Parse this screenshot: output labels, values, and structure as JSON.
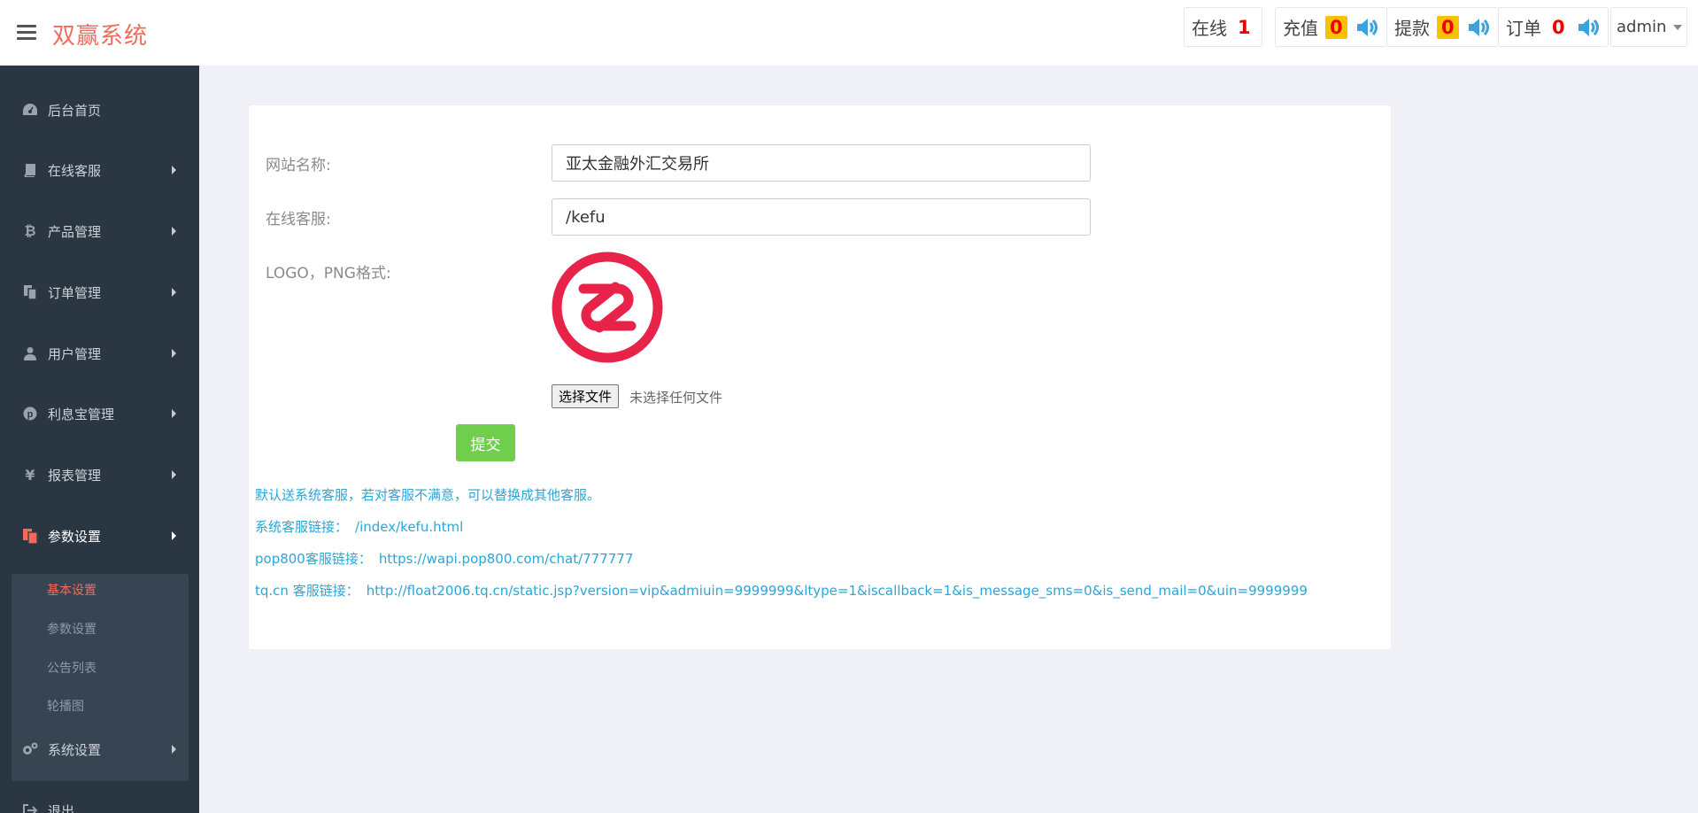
{
  "header": {
    "brand": "双赢系统",
    "stats": [
      {
        "label": "在线",
        "value": "1"
      },
      {
        "label": "充值",
        "value": "0"
      },
      {
        "label": "提款",
        "value": "0"
      },
      {
        "label": "订单",
        "value": "0"
      }
    ],
    "user": "admin"
  },
  "sidebar": {
    "items": [
      {
        "label": "后台首页",
        "icon": "dashboard-icon"
      },
      {
        "label": "在线客服",
        "icon": "book-icon"
      },
      {
        "label": "产品管理",
        "icon": "bitcoin-icon"
      },
      {
        "label": "订单管理",
        "icon": "copy-icon"
      },
      {
        "label": "用户管理",
        "icon": "user-icon"
      },
      {
        "label": "利息宝管理",
        "icon": "pinterest-icon"
      },
      {
        "label": "报表管理",
        "icon": "yen-icon"
      },
      {
        "label": "参数设置",
        "icon": "files-icon"
      },
      {
        "label": "系统设置",
        "icon": "cogs-icon"
      },
      {
        "label": "退出",
        "icon": "sign-out-icon"
      }
    ],
    "sub_items": [
      {
        "label": "基本设置",
        "active": true
      },
      {
        "label": "参数设置",
        "active": false
      },
      {
        "label": "公告列表",
        "active": false
      },
      {
        "label": "轮播图",
        "active": false
      }
    ]
  },
  "form": {
    "site_name_label": "网站名称:",
    "site_name_value": "亚太金融外汇交易所",
    "kefu_label": "在线客服:",
    "kefu_value": "/kefu",
    "logo_label": "LOGO，PNG格式:",
    "file_button": "选择文件",
    "file_status": "未选择任何文件",
    "submit": "提交"
  },
  "notes": {
    "line1": "默认送系统客服，若对客服不满意，可以替换成其他客服。",
    "line2_label": "系统客服链接：",
    "line2_link": "/index/kefu.html",
    "line3_label": "pop800客服链接：",
    "line3_link": "https://wapi.pop800.com/chat/777777",
    "line4_label": "tq.cn 客服链接：",
    "line4_link": "http://float2006.tq.cn/static.jsp?version=vip&admiuin=9999999&ltype=1&iscallback=1&is_message_sms=0&is_send_mail=0&uin=9999999"
  },
  "colors": {
    "brand": "#f06c5e",
    "sidebar_bg": "#2b3643",
    "active": "#f36a5a",
    "submit": "#6fcf4c",
    "note": "#2aa6d8",
    "logo_red": "#e8234a"
  }
}
